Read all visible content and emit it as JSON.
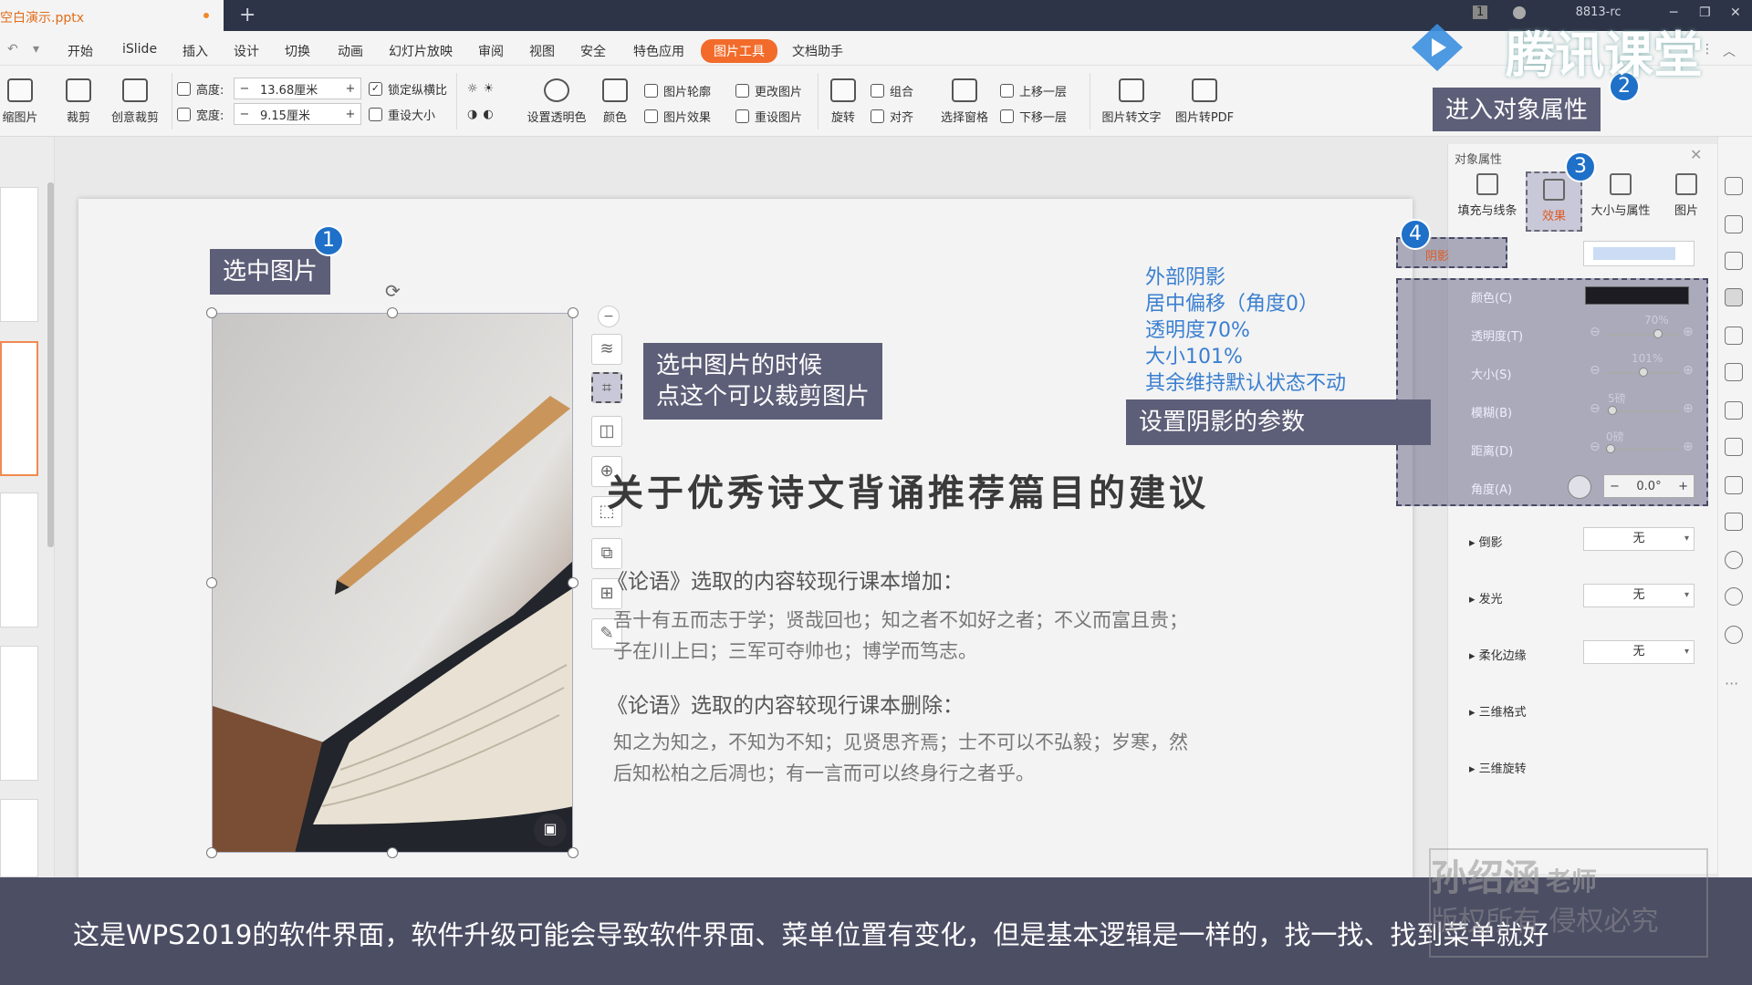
{
  "titlebar": {
    "file_tab": "空白演示.pptx",
    "new_tab": "+",
    "account_badge": "1",
    "account_id": "8813-rc"
  },
  "menu": [
    "开始",
    "iSlide",
    "插入",
    "设计",
    "切换",
    "动画",
    "幻灯片放映",
    "审阅",
    "视图",
    "安全",
    "特色应用"
  ],
  "menu_active": "图片工具",
  "menu_after": "文档助手",
  "ribbon": {
    "thumb_label": "缩图片",
    "crop": "裁剪",
    "creative_crop": "创意裁剪",
    "height_label": "高度:",
    "height_value": "13.68厘米",
    "width_label": "宽度:",
    "width_value": "9.15厘米",
    "lock_ratio": "锁定纵横比",
    "reset_size": "重设大小",
    "transparent": "设置透明色",
    "color": "颜色",
    "outline": "图片轮廓",
    "effects": "图片效果",
    "change": "更改图片",
    "reset": "重设图片",
    "rotate": "旋转",
    "group": "组合",
    "align": "对齐",
    "selection_pane": "选择窗格",
    "bring_forward": "上移一层",
    "send_backward": "下移一层",
    "to_text": "图片转文字",
    "to_pdf": "图片转PDF"
  },
  "slide": {
    "title": "关于优秀诗文背诵推荐篇目的建议",
    "heading1": "《论语》选取的内容较现行课本增加：",
    "body1_line1": "吾十有五而志于学；贤哉回也；知之者不如好之者；不义而富且贵；",
    "body1_line2": "子在川上曰；三军可夺帅也；博学而笃志。",
    "heading2": "《论语》选取的内容较现行课本删除：",
    "body2_line1": "知之为知之，不知为不知；见贤思齐焉；士不可以不弘毅；岁寒，然",
    "body2_line2": "后知松柏之后凋也；有一言而可以终身行之者乎。"
  },
  "notes": [
    "外部阴影",
    "居中偏移（角度0）",
    "透明度70%",
    "大小101%",
    "其余维持默认状态不动"
  ],
  "callouts": {
    "select_image": "选中图片",
    "crop_hint_line1": "选中图片的时候",
    "crop_hint_line2": "点这个可以裁剪图片",
    "shadow_params": "设置阴影的参数",
    "enter_props": "进入对象属性"
  },
  "badges": [
    "1",
    "2",
    "3",
    "4"
  ],
  "panel": {
    "title": "对象属性",
    "tabs": [
      "填充与线条",
      "效果",
      "大小与属性",
      "图片"
    ],
    "shadow": "阴影",
    "color_label": "颜色(C)",
    "transparency_label": "透明度(T)",
    "transparency_value": "70%",
    "size_label": "大小(S)",
    "size_value": "101%",
    "blur_label": "模糊(B)",
    "blur_value": "5磅",
    "distance_label": "距离(D)",
    "distance_value": "0磅",
    "angle_label": "角度(A)",
    "angle_value": "0.0°",
    "reflection": "倒影",
    "reflection_value": "无",
    "glow": "发光",
    "glow_value": "无",
    "soft_edge": "柔化边缘",
    "soft_edge_value": "无",
    "format_3d": "三维格式",
    "rotation_3d": "三维旋转"
  },
  "caption": "这是WPS2019的软件界面，软件升级可能会导致软件界面、菜单位置有变化，但是基本逻辑是一样的，找一找、找到菜单就好",
  "watermark": {
    "brand": "腾讯课堂",
    "teacher": "孙绍涵",
    "teacher_suffix": "老师",
    "copyright": "版权所有 侵权必究"
  },
  "colors": {
    "accent": "#f26b2a",
    "callout": "#5d5f78",
    "badge": "#1e70c8",
    "note": "#3a7fd0",
    "caption_bg": "#4c4e64"
  }
}
